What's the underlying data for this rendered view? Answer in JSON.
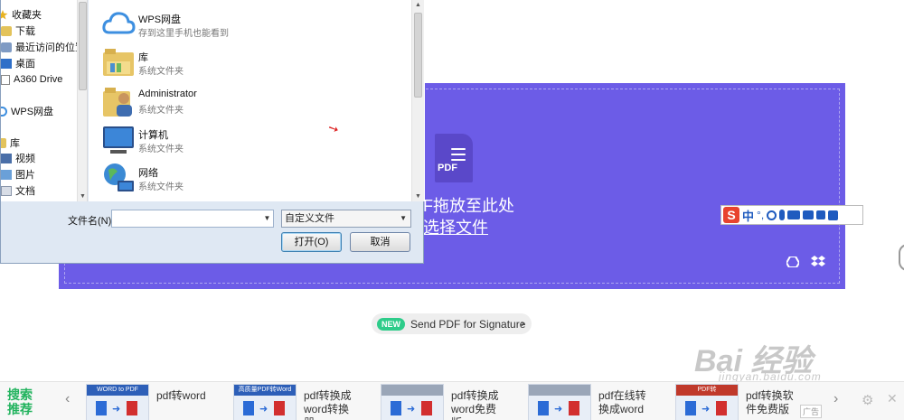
{
  "dialog": {
    "nav_items": [
      {
        "label": "收藏夹",
        "icon": "star-icon"
      },
      {
        "label": "下载",
        "icon": "download-folder-icon"
      },
      {
        "label": "最近访问的位置",
        "icon": "recent-places-icon"
      },
      {
        "label": "桌面",
        "icon": "desktop-icon"
      },
      {
        "label": "A360 Drive",
        "icon": "drive-file-icon"
      },
      {
        "label": "WPS网盘",
        "icon": "cloud-icon"
      },
      {
        "label": "库",
        "icon": "library-icon"
      },
      {
        "label": "视频",
        "icon": "video-icon"
      },
      {
        "label": "图片",
        "icon": "picture-icon"
      },
      {
        "label": "文档",
        "icon": "document-icon"
      }
    ],
    "items": [
      {
        "name": "WPS网盘",
        "sub": "存到这里手机也能看到",
        "icon": "cloud-icon"
      },
      {
        "name": "库",
        "sub": "系统文件夹",
        "icon": "library-folder-icon"
      },
      {
        "name": "Administrator",
        "sub": "系统文件夹",
        "icon": "user-folder-icon"
      },
      {
        "name": "计算机",
        "sub": "系统文件夹",
        "icon": "computer-icon"
      },
      {
        "name": "网络",
        "sub": "系统文件夹",
        "icon": "network-globe-icon"
      }
    ],
    "filename_label": "文件名(N):",
    "filename_value": "",
    "filetype_value": "自定义文件",
    "open_label": "打开(O)",
    "cancel_label": "取消"
  },
  "dropzone": {
    "file_icon_label": "PDF",
    "drop_text": "F拖放至此处",
    "choose_text": "选择文件"
  },
  "ime": {
    "logo": "S",
    "mode": "中",
    "punct": "°,"
  },
  "signature": {
    "badge": "NEW",
    "text": "Send PDF for Signature",
    "chevron": "›"
  },
  "watermark": {
    "text": "Bai 经验",
    "sub": "jingyan.baidu.com"
  },
  "recommend": {
    "label": "搜索推荐",
    "prev": "‹",
    "next": "›",
    "ad": "广告",
    "items": [
      {
        "thumb_title": "WORD to PDF",
        "text": "pdf转word"
      },
      {
        "thumb_title": "高质量PDF转Word",
        "text": "pdf转换成word转换器"
      },
      {
        "thumb_title": "",
        "text": "pdf转换成word免费版"
      },
      {
        "thumb_title": "",
        "text": "pdf在线转换成word"
      },
      {
        "thumb_title": "PDF转",
        "text": "pdf转换软件免费版"
      }
    ]
  }
}
